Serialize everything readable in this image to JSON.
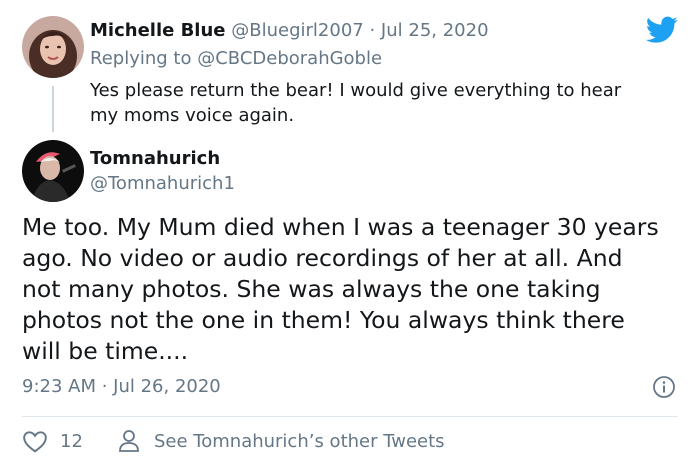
{
  "reply_tweet": {
    "author_name": "Michelle Blue",
    "handle": "@Bluegirl2007",
    "separator": "·",
    "date": "Jul 25, 2020",
    "replying_prefix": "Replying to",
    "replying_handle": "@CBCDeborahGoble",
    "text_line1": "Yes please return the bear! I would give everything to hear",
    "text_line2": "my moms voice again."
  },
  "main_tweet": {
    "author_name": "Tomnahurich",
    "handle": "@Tomnahurich1",
    "text_lines": [
      "Me too. My Mum died when I was a teenager 30 years",
      "ago. No video or audio recordings of her at all. And",
      "not many photos. She was always the one taking",
      "photos not the one in them! You always think there",
      "will be time...."
    ],
    "timestamp": "9:23 AM · Jul 26, 2020",
    "like_count": "12",
    "other_tweets_label": "See Tomnahurich’s other Tweets"
  },
  "colors": {
    "twitter_blue": "#1da1f2",
    "muted": "#657786",
    "text": "#14171a",
    "divider": "#e1e8ed"
  },
  "icons": {
    "brand": "twitter-bird-icon",
    "info": "info-icon",
    "like": "heart-icon",
    "profile": "person-icon"
  }
}
